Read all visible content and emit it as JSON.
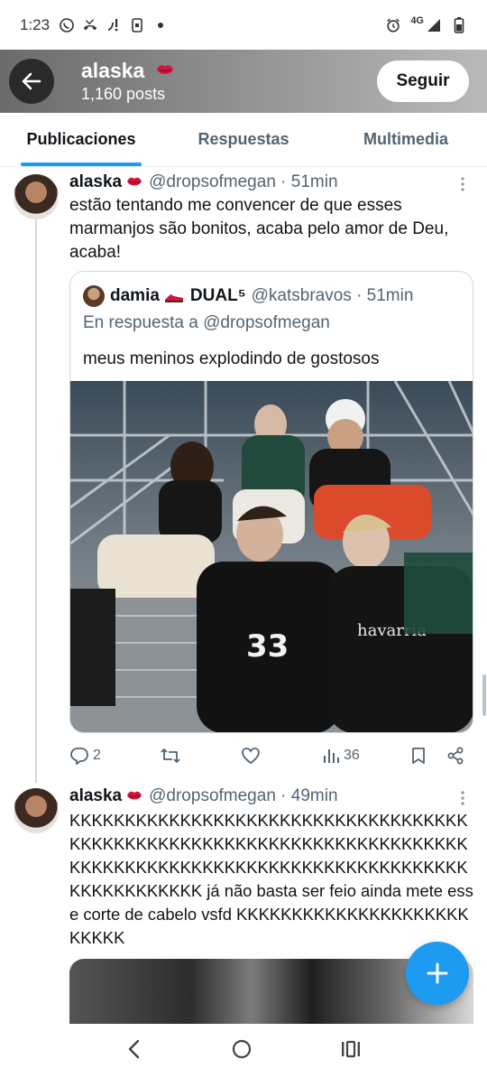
{
  "status_bar": {
    "time": "1:23",
    "network": "4G"
  },
  "header": {
    "name": "alaska",
    "posts": "1,160 posts",
    "follow_label": "Seguir"
  },
  "tabs": [
    {
      "label": "Publicaciones",
      "active": true
    },
    {
      "label": "Respuestas",
      "active": false
    },
    {
      "label": "Multimedia",
      "active": false
    }
  ],
  "tweets": [
    {
      "display_name": "alaska",
      "handle": "@dropsofmegan · 51min",
      "text": "estão tentando me convencer de que esses marmanjos são bonitos, acaba pelo amor de Deu, acaba!",
      "quote": {
        "display_name": "damia",
        "display_suffix": "DUAL⁵",
        "handle": "@katsbravos · 51min",
        "reply_to": "En respuesta a @dropsofmegan",
        "text": "meus meninos explodindo de gostosos"
      },
      "actions": {
        "replies": "2",
        "views": "36"
      }
    },
    {
      "display_name": "alaska",
      "handle": "@dropsofmegan · 49min",
      "text": "KKKKKKKKKKKKKKKKKKKKKKKKKKKKKKKKKKKKKKKKKKKKKKKKKKKKKKKKKKKKKKKKKKKKKKKKKKKKKKKKKKKKKKKKKKKKKKKKKKKKKKKKKKKKKKKKKKKKKKKK já não basta ser feio ainda mete esse corte de cabelo vsfd KKKKKKKKKKKKKKKKKKKKKKKKKK"
    }
  ],
  "colors": {
    "accent": "#1d9bf0",
    "text": "#0f1419",
    "muted": "#536471"
  }
}
